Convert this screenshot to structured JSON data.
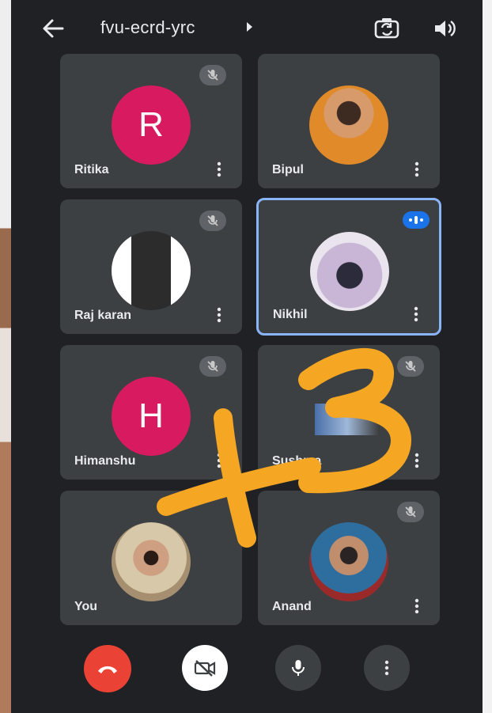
{
  "header": {
    "room_code": "fvu-ecrd-yrc",
    "icons": {
      "back": "arrow-left-icon",
      "room_details": "caret-right-icon",
      "camera_switch": "camera-switch-icon",
      "audio": "speaker-icon"
    }
  },
  "tiles": [
    {
      "name": "Ritika",
      "avatar_letter": "R",
      "avatar_color": "#d81b60",
      "muted": true
    },
    {
      "name": "Bipul",
      "avatar": "photo",
      "muted": false
    },
    {
      "name": "Raj karan",
      "avatar": "photo",
      "muted": true
    },
    {
      "name": "Nikhil",
      "avatar": "photo",
      "muted": false,
      "speaking": true
    },
    {
      "name": "Himanshu",
      "avatar_letter": "H",
      "avatar_color": "#d81b60",
      "muted": true
    },
    {
      "name": "Sushma",
      "avatar": "photo",
      "muted": true
    },
    {
      "name": "You",
      "avatar": "photo",
      "muted": false
    },
    {
      "name": "Anand",
      "avatar": "photo",
      "muted": true
    }
  ],
  "controls": {
    "end_call": "end-call-icon",
    "camera_off": "camera-off-icon",
    "microphone": "microphone-icon",
    "more_options": "more-vert-icon"
  },
  "annotation": {
    "text": "+3",
    "color": "#f5a623"
  },
  "colors": {
    "background": "#202124",
    "tile": "#3c4043",
    "active_border": "#8ab4f8",
    "end_call": "#ea4335",
    "avatar_pink": "#d81b60"
  }
}
